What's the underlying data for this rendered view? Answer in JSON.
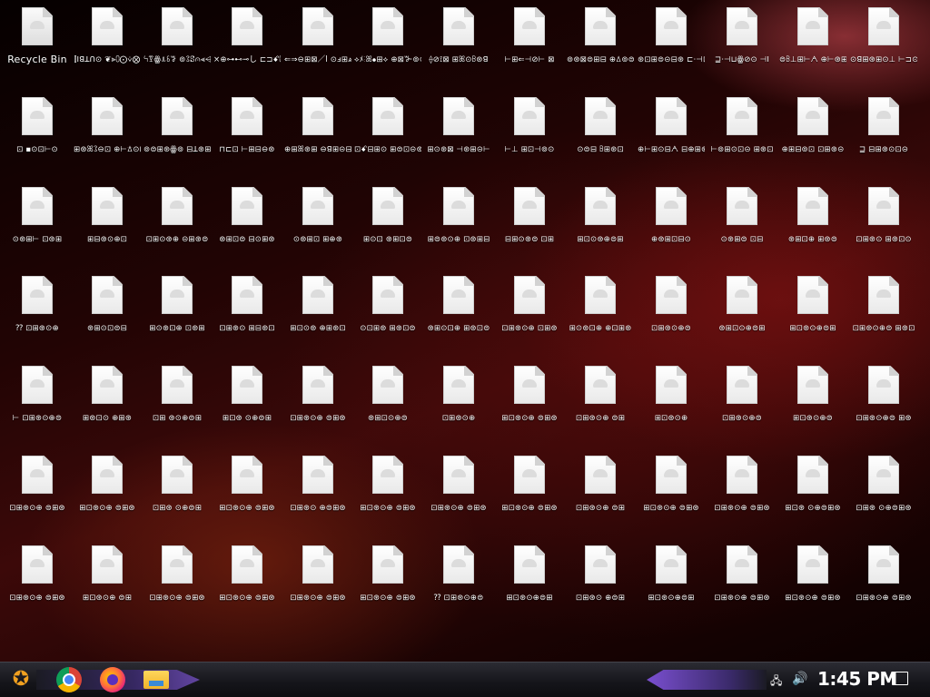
{
  "desktop": {
    "icons": [
      [
        "Recycle Bin",
        "⫿ꓲꓭꓕꓵ⊙ ❦⫸⩇⨀⩒⨂",
        "ꕪꗑꙮꕊꗏꗌ ⊚ꕘꗟ⩀⫷⩤",
        "×⊕⊶⊷⊸し ⊏⊐ꗄ⩇⊕ⅎ",
        "⇐⇒⊖⊞⊠／ⅼ ⊙ⅎ⊞⩓⊕⊠",
        "⟡ﾒ⫶ꕤ⦁⊞⟡ ⊕⊠ꔐ⊚⊙",
        "⟠⊘⟟⊠ ⊞ꕤ⊙ꕗ⊛ꓭ",
        "⊢⊞⇐⊣⊘⊢ ⊠",
        "⊚⊛⊠⊜⊞⊟ ⊕ꕔ⊚⊜",
        "⊛⊡⊞⊜⊝⊟⊛ ⊏⋅⊣⊡⊥",
        "⊒⋅⊣⊔ꙮ⊘⊙ ⊣ꓲ",
        "⊜ꕗ⊥⊞⊢ᗅ ⊕⊢⊛⊞⊝",
        "⊙ꓭ⊞⊛⊞⊙⊥ ⊢⊐⊙⊢"
      ],
      [
        "⊡ ▪⊙⊡⊢⊙",
        "⊞⊛ꕤꕘ⊖⊡ ⊕⊢ꕖ⊙⊞",
        "⊚⊜⊞⊛ꙮ⊚ ⊟ꓕ⊛⊞⊟",
        "⊓⊏⊡ ⊢⊞⊟⊖⊛",
        "⊕⊞ꕤ⊛⊞ ⊖ꓭ⊞⊝⊟",
        "⊡ꗄ⊟⊞⊙ ⊞⊜⊡⊝⊛",
        "⊞⊙⊛⊠ ⊣⊛⊞⊝⊢",
        "⊢⊥ ⊞⊡⊣⊚⊙",
        "⊙⊜⊟ ꕗ⊞⊛⊡",
        "⊕⊢⊞⊙⊟ᗅ ⊟⊕⊞⊛",
        "⊢⊚⊞⊙⊡⊝ ⊞⊛⊡",
        "⊕⊞⊟⊚⊡ ⊡⊞⊛⊝",
        "⊒ ⊟⊞⊛⊙⊡⊝"
      ],
      [
        "⊙⊛⊞⊢ ⊡⊛⊞",
        "⊞⊟⊛⊙⊕⊡",
        "⊡⊞⊙⊛⊕ ⊝⊞⊛⊜",
        "⊛⊞⊡⊜ ⊟⊙⊞⊛",
        "⊙⊛⊞⊡ ⊞⊕⊛",
        "⊞⊙⊡ ⊛⊞⊡⊜",
        "⊞⊜⊛⊙⊕ ⊡⊛⊞⊟",
        "⊟⊞⊙⊛⊜ ⊡⊞",
        "⊞⊡⊙⊛⊕⊜⊞",
        "⊕⊛⊞⊡⊟⊙",
        "⊙⊛⊞⊜ ⊡⊟",
        "⊛⊞⊡⊕ ⊞⊛⊜",
        "⊡⊞⊛⊙ ⊞⊛⊡⊙"
      ],
      [
        "⁇ ⊡⊞⊛⊙⊕",
        "⊛⊞⊙⊡⊜⊟",
        "⊞⊙⊛⊡⊕ ⊡⊛⊞",
        "⊡⊞⊛⊙ ⊞⊟⊛⊡",
        "⊞⊡⊙⊛ ⊕⊞⊛⊡",
        "⊙⊡⊞⊛ ⊞⊛⊡⊜",
        "⊛⊞⊙⊡⊕ ⊞⊛⊡⊜",
        "⊡⊞⊛⊙⊕ ⊡⊞⊛",
        "⊞⊙⊛⊡⊕ ⊕⊡⊞⊛",
        "⊡⊞⊛⊙⊕⊜",
        "⊛⊞⊡⊙⊕⊜⊞",
        "⊞⊡⊛⊙⊕⊜⊞",
        "⊡⊞⊛⊙⊕⊜ ⊞⊛⊡"
      ],
      [
        "⊢ ⊡⊞⊛⊙⊕⊜",
        "⊞⊛⊡⊙ ⊕⊞⊛",
        "⊡⊞ ⊛⊙⊕⊜⊞",
        "⊞⊡⊛ ⊙⊕⊜⊞",
        "⊡⊞⊛⊙⊕ ⊜⊞⊛",
        "⊛⊞⊡⊙⊕⊜",
        "⊡⊞⊛⊙⊕",
        "⊞⊡⊛⊙⊕ ⊜⊞⊛",
        "⊡⊞⊛⊙⊕ ⊜⊞",
        "⊞⊡⊛⊙⊕",
        "⊡⊞⊛⊙⊕⊜",
        "⊞⊡⊛⊙⊕⊜",
        "⊡⊞⊛⊙⊕⊜ ⊞⊛"
      ],
      [
        "⊡⊞⊛⊙⊕ ⊜⊞⊛",
        "⊞⊡⊛⊙⊕ ⊜⊞⊛",
        "⊡⊞⊛ ⊙⊕⊜⊞",
        "⊞⊡⊛⊙⊕ ⊜⊞⊛",
        "⊡⊞⊛⊙ ⊕⊜⊞⊛",
        "⊞⊡⊛⊙⊕ ⊜⊞⊛",
        "⊡⊞⊛⊙⊕ ⊜⊞⊛",
        "⊞⊡⊛⊙⊕ ⊜⊞⊛",
        "⊡⊞⊛⊙⊕ ⊜⊞",
        "⊞⊡⊛⊙⊕ ⊜⊞⊛",
        "⊡⊞⊛⊙⊕ ⊜⊞⊛",
        "⊞⊡⊛ ⊙⊕⊜⊞⊛",
        "⊡⊞⊛ ⊙⊕⊜⊞⊛"
      ],
      [
        "⊡⊞⊛⊙⊕ ⊜⊞⊛",
        "⊞⊡⊛⊙⊕ ⊜⊞",
        "⊡⊞⊛⊙⊕ ⊜⊞⊛",
        "⊞⊡⊛⊙⊕ ⊜⊞⊛",
        "⊡⊞⊛⊙⊕ ⊜⊞⊛",
        "⊞⊡⊛⊙⊕ ⊜⊞⊛",
        "⁇ ⊡⊞⊛⊙⊕⊜",
        "⊞⊡⊛⊙⊕⊜⊞",
        "⊡⊞⊛⊙ ⊕⊜⊞",
        "⊞⊡⊛⊙⊕⊜⊞",
        "⊡⊞⊛⊙⊕ ⊜⊞⊛",
        "⊞⊡⊛⊙⊕ ⊜⊞⊛",
        "⊡⊞⊛⊙⊕ ⊜⊞⊛"
      ]
    ]
  },
  "taskbar": {
    "clock": "1:45 PM",
    "apps": [
      "chrome-icon",
      "firefox-icon",
      "file-explorer-icon"
    ]
  }
}
